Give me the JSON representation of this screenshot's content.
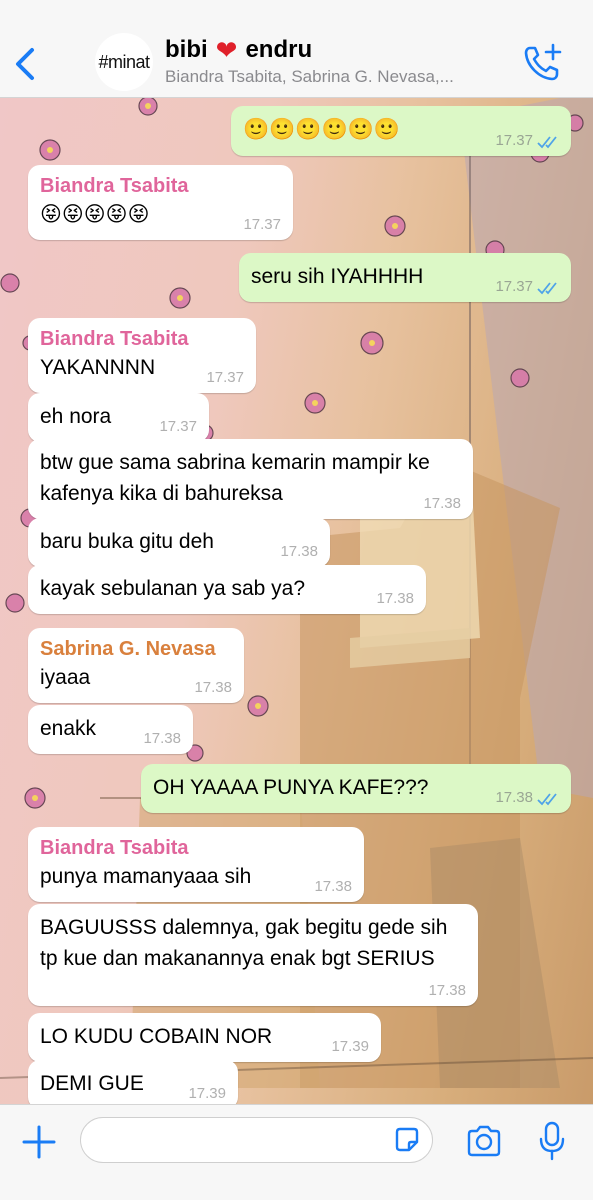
{
  "header": {
    "avatar_text": "#minat",
    "title_left": "bibi",
    "title_heart": "❤",
    "title_right": "endru",
    "subtitle": "Biandra Tsabita, Sabrina G. Nevasa,...",
    "back_icon": "chevron-left-icon",
    "call_icon": "add-call-icon"
  },
  "colors": {
    "accent": "#1a7cf5",
    "outgoing_bubble": "#dcf8c6",
    "incoming_bubble": "#ffffff",
    "sender_biandra": "#e0659b",
    "sender_sabrina": "#d9803d",
    "ticks": "#4fa3e8"
  },
  "messages": [
    {
      "dir": "out",
      "text": "🙂🙂🙂🙂🙂🙂",
      "time": "17.37"
    },
    {
      "dir": "in",
      "sender": "Biandra Tsabita",
      "text": "😝😝😝😝😝",
      "time": "17.37"
    },
    {
      "dir": "out",
      "text": "seru sih IYAHHHH",
      "time": "17.37"
    },
    {
      "dir": "in",
      "sender": "Biandra Tsabita",
      "text": "YAKANNNN",
      "time": "17.37"
    },
    {
      "dir": "in",
      "text": "eh nora",
      "time": "17.37"
    },
    {
      "dir": "in",
      "text": "btw gue sama sabrina kemarin mampir ke kafenya kika di bahureksa",
      "time": "17.38"
    },
    {
      "dir": "in",
      "text": "baru buka gitu deh",
      "time": "17.38"
    },
    {
      "dir": "in",
      "text": "kayak sebulanan ya sab ya?",
      "time": "17.38"
    },
    {
      "dir": "in",
      "sender": "Sabrina G. Nevasa",
      "text": "iyaaa",
      "time": "17.38"
    },
    {
      "dir": "in",
      "text": "enakk",
      "time": "17.38"
    },
    {
      "dir": "out",
      "text": "OH YAAAA PUNYA KAFE???",
      "time": "17.38"
    },
    {
      "dir": "in",
      "sender": "Biandra Tsabita",
      "text": "punya mamanyaaa sih",
      "time": "17.38"
    },
    {
      "dir": "in",
      "text": "BAGUUSSS dalemnya, gak begitu gede sih tp kue dan makanannya enak bgt SERIUS",
      "time": "17.38"
    },
    {
      "dir": "in",
      "text": "LO KUDU COBAIN NOR",
      "time": "17.39"
    },
    {
      "dir": "in",
      "text": "DEMI GUE",
      "time": "17.39"
    }
  ],
  "input": {
    "placeholder": "",
    "plus_icon": "plus-icon",
    "sticker_icon": "sticker-icon",
    "camera_icon": "camera-icon",
    "mic_icon": "microphone-icon"
  }
}
